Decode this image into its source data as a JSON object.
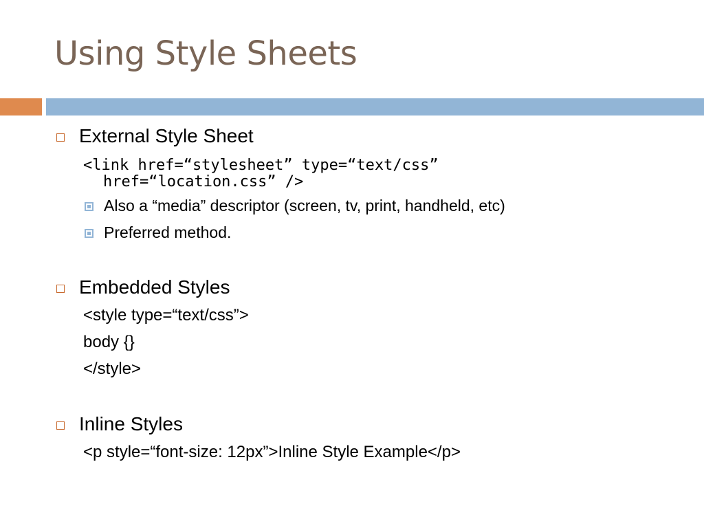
{
  "title": "Using Style Sheets",
  "sections": {
    "external": {
      "heading": "External Style Sheet",
      "code_line1": "<link href=“stylesheet” type=“text/css”",
      "code_line2": "href=“location.css” />",
      "bullets": [
        "Also a “media” descriptor (screen, tv, print, handheld, etc)",
        "Preferred method."
      ]
    },
    "embedded": {
      "heading": "Embedded Styles",
      "lines": [
        "<style type=“text/css”>",
        "body {}",
        "</style>"
      ]
    },
    "inline": {
      "heading": "Inline Styles",
      "line": "<p style=“font-size: 12px”>Inline Style Example</p>"
    }
  }
}
